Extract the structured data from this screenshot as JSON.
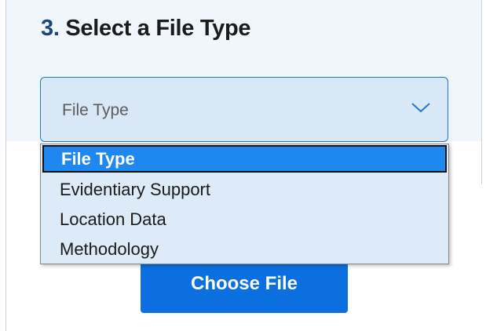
{
  "section": {
    "step_number": "3.",
    "title": "Select a File Type"
  },
  "file_type_select": {
    "current_value": "File Type",
    "options": [
      {
        "label": "File Type",
        "selected": true
      },
      {
        "label": "Evidentiary Support",
        "selected": false
      },
      {
        "label": "Location Data",
        "selected": false
      },
      {
        "label": "Methodology",
        "selected": false
      }
    ]
  },
  "upload": {
    "choose_label": "Choose File"
  },
  "colors": {
    "accent": "#1e88f0",
    "select_bg": "#d9e8f6",
    "button_bg": "#0b6fe0",
    "title_number": "#1a4480"
  }
}
